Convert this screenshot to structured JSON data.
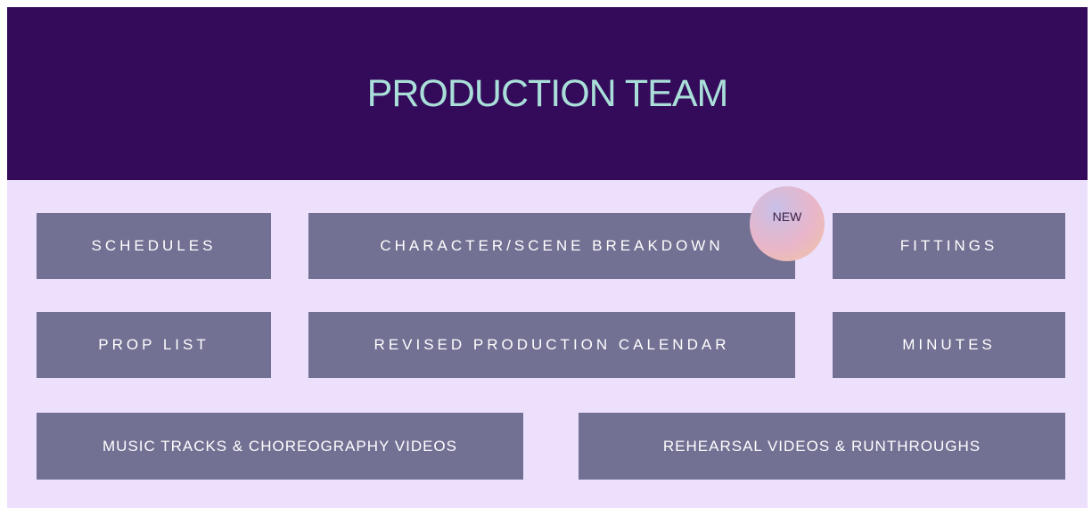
{
  "header": {
    "title": "PRODUCTION TEAM"
  },
  "buttons": {
    "schedules": "SCHEDULES",
    "character_breakdown": "CHARACTER/SCENE BREAKDOWN",
    "fittings": "FITTINGS",
    "prop_list": "PROP LIST",
    "production_calendar": "REVISED PRODUCTION CALENDAR",
    "minutes": "MINUTES",
    "music_tracks": "MUSIC TRACKS & CHOREOGRAPHY VIDEOS",
    "rehearsal_videos": "REHEARSAL VIDEOS & RUNTHROUGHS"
  },
  "badge": {
    "label": "NEW"
  },
  "colors": {
    "header_bg": "#340a5b",
    "title_text": "#a9dfd8",
    "panel_bg": "#ede0fd",
    "button_bg": "#727093",
    "button_text": "#ffffff"
  }
}
